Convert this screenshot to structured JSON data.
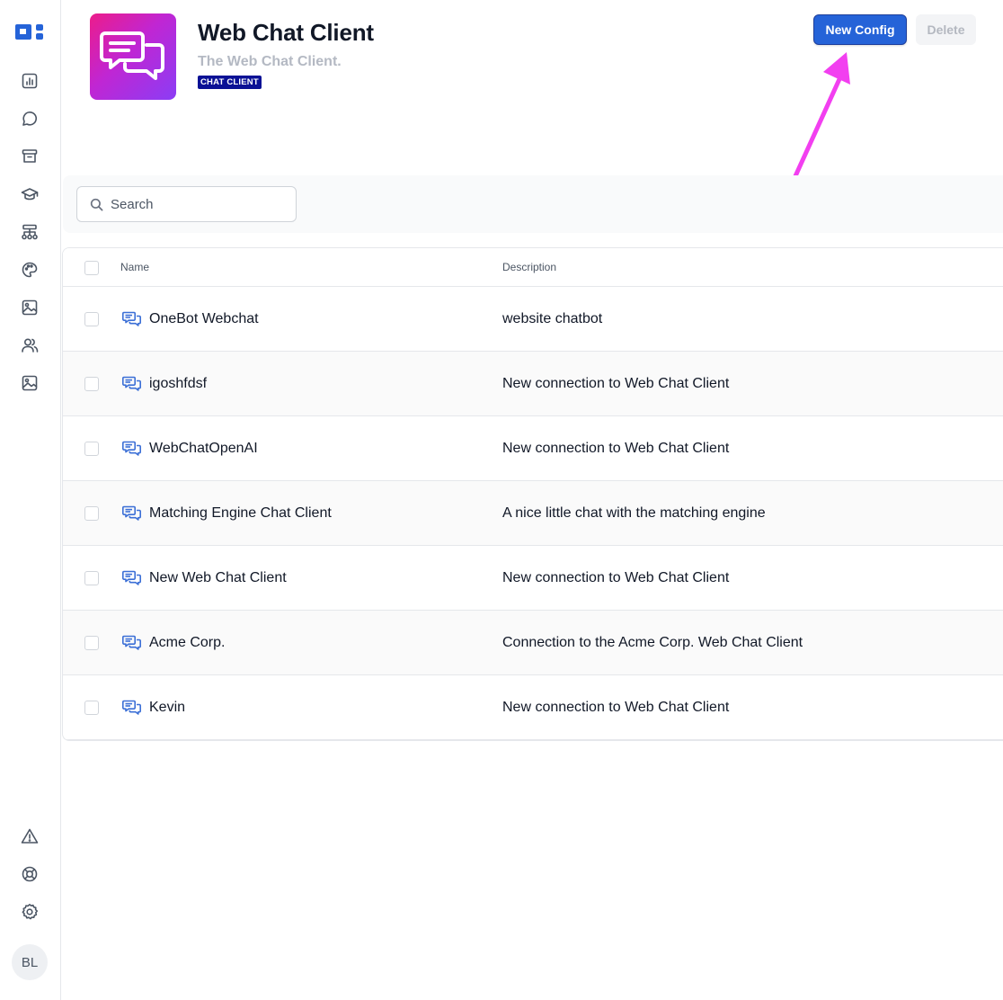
{
  "sidebar": {
    "logo_icon": "brand-logo-icon",
    "nav_icons": [
      "bar-chart-icon",
      "chat-bubble-icon",
      "archive-icon",
      "graduation-cap-icon",
      "sitemap-icon",
      "palette-icon",
      "image-icon",
      "users-icon",
      "image-icon-2"
    ],
    "bottom_icons": [
      "warning-icon",
      "lifebuoy-icon",
      "gear-icon"
    ],
    "avatar_initials": "BL"
  },
  "header": {
    "title": "Web Chat Client",
    "subtitle": "The Web Chat Client.",
    "badge": "CHAT CLIENT",
    "new_button_label": "New Config",
    "delete_button_label": "Delete"
  },
  "search": {
    "placeholder": "Search",
    "value": ""
  },
  "table": {
    "columns": [
      "Name",
      "Description"
    ],
    "rows": [
      {
        "name": "OneBot Webchat",
        "description": "website chatbot"
      },
      {
        "name": "igoshfdsf",
        "description": "New connection to Web Chat Client"
      },
      {
        "name": "WebChatOpenAI",
        "description": "New connection to Web Chat Client"
      },
      {
        "name": "Matching Engine Chat Client",
        "description": "A nice little chat with the matching engine"
      },
      {
        "name": "New Web Chat Client",
        "description": "New connection to Web Chat Client"
      },
      {
        "name": "Acme Corp.",
        "description": "Connection to the Acme Corp. Web Chat Client"
      },
      {
        "name": "Kevin",
        "description": "New connection to Web Chat Client"
      }
    ]
  },
  "colors": {
    "primary_button": "#2563d8",
    "badge_bg": "#0a1195",
    "annotation_arrow": "#f23ff0",
    "row_icon": "#3b6fd6"
  }
}
